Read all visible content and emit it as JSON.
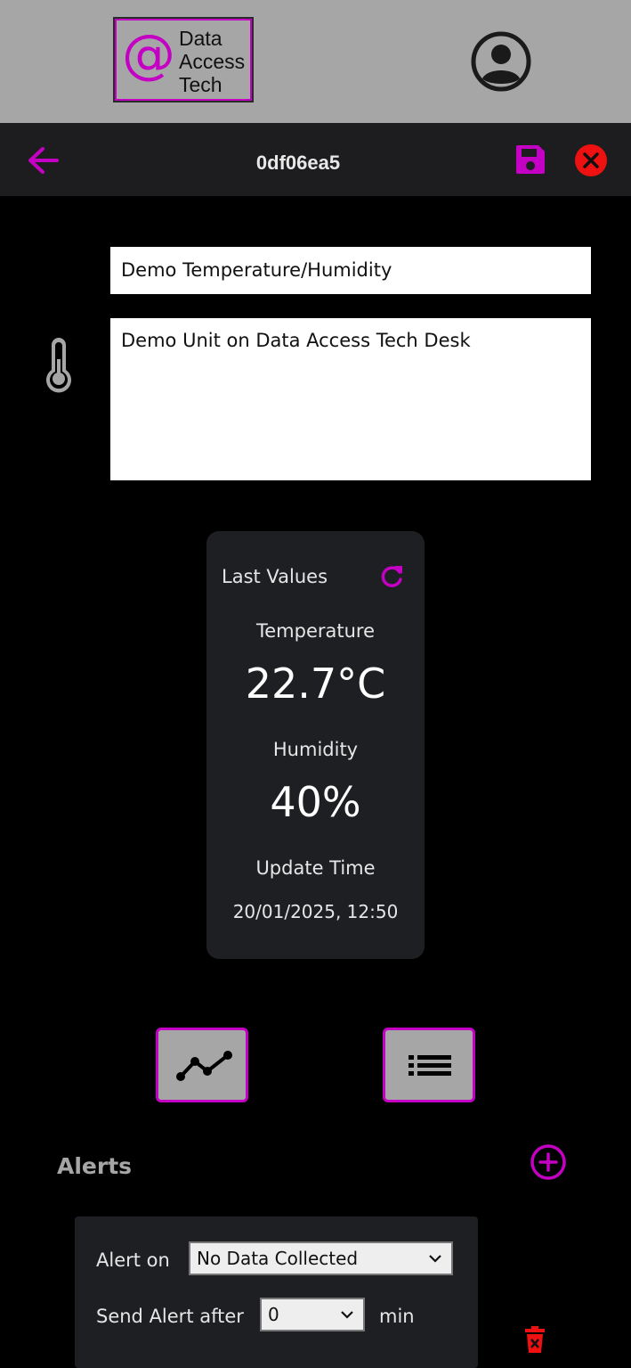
{
  "header": {
    "logo": {
      "symbol": "@",
      "lines": [
        "Data",
        "Access",
        "Tech"
      ]
    },
    "avatar_icon": "account-circle-icon"
  },
  "navbar": {
    "title": "0df06ea5",
    "back_icon": "arrow-left-icon",
    "save_icon": "floppy-save-icon",
    "close_icon": "close-circle-icon"
  },
  "device": {
    "name": "Demo Temperature/Humidity",
    "description": "Demo Unit on Data Access Tech Desk",
    "icon": "thermometer-icon"
  },
  "last_values": {
    "heading": "Last Values",
    "refresh_icon": "refresh-icon",
    "temperature_label": "Temperature",
    "temperature_value": "22.7°C",
    "humidity_label": "Humidity",
    "humidity_value": "40%",
    "update_time_label": "Update Time",
    "update_time_value": "20/01/2025, 12:50"
  },
  "view_buttons": {
    "chart_icon": "line-chart-icon",
    "list_icon": "list-icon"
  },
  "alerts": {
    "title": "Alerts",
    "add_icon": "plus-circle-icon",
    "items": [
      {
        "alert_on_label": "Alert on",
        "alert_on_value": "No Data Collected",
        "send_after_label": "Send Alert after",
        "send_after_value": "0",
        "unit": "min",
        "delete_icon": "trash-x-icon"
      }
    ]
  },
  "colors": {
    "accent": "#c400c4",
    "header_bg": "#a6a6a6",
    "navbar_bg": "#1d1d1f",
    "card_bg": "#1e1f22",
    "close_red": "#ee1111",
    "page_bg": "#000000"
  }
}
